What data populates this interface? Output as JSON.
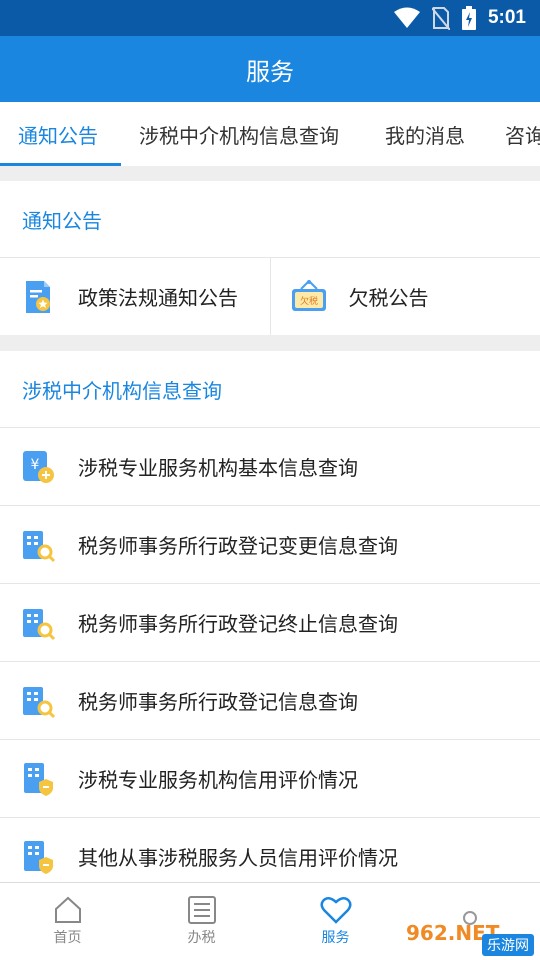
{
  "status_bar": {
    "time": "5:01"
  },
  "header": {
    "title": "服务"
  },
  "tabs": [
    {
      "label": "通知公告",
      "active": true
    },
    {
      "label": "涉税中介机构信息查询",
      "active": false
    },
    {
      "label": "我的消息",
      "active": false
    },
    {
      "label": "咨询",
      "active": false
    }
  ],
  "section_notice": {
    "title": "通知公告",
    "items": [
      {
        "label": "政策法规通知公告",
        "icon": "policy-doc-icon"
      },
      {
        "label": "欠税公告",
        "icon": "tax-arrears-sign-icon",
        "icon_text": "欠税"
      }
    ]
  },
  "section_agency": {
    "title": "涉税中介机构信息查询",
    "items": [
      {
        "label": "涉税专业服务机构基本信息查询",
        "icon": "yuan-agency-icon"
      },
      {
        "label": "税务师事务所行政登记变更信息查询",
        "icon": "building-search-icon"
      },
      {
        "label": "税务师事务所行政登记终止信息查询",
        "icon": "building-search-icon"
      },
      {
        "label": "税务师事务所行政登记信息查询",
        "icon": "building-search-icon"
      },
      {
        "label": "涉税专业服务机构信用评价情况",
        "icon": "building-shield-icon"
      },
      {
        "label": "其他从事涉税服务人员信用评价情况",
        "icon": "building-shield-icon"
      }
    ]
  },
  "bottom_nav": [
    {
      "label": "首页",
      "icon": "home-icon",
      "active": false
    },
    {
      "label": "办税",
      "icon": "list-icon",
      "active": false
    },
    {
      "label": "服务",
      "icon": "heart-icon",
      "active": true
    }
  ],
  "watermark": {
    "logo": "962.NET",
    "text": "乐游网"
  },
  "colors": {
    "primary": "#1a86df",
    "status_bar": "#0b5aa8",
    "background": "#eeeeee"
  }
}
